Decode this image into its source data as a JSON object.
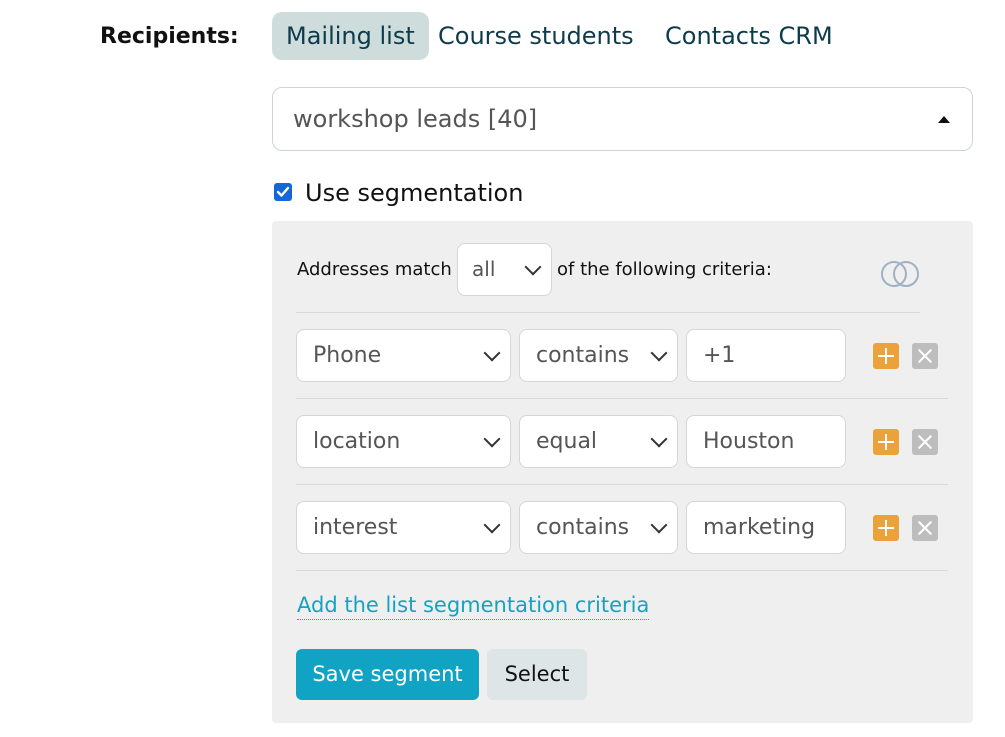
{
  "recipients_label": "Recipients:",
  "tabs": [
    {
      "label": "Mailing list",
      "active": true
    },
    {
      "label": "Course students",
      "active": false
    },
    {
      "label": "Contacts CRM",
      "active": false
    }
  ],
  "list_select": {
    "value": "workshop leads [40]"
  },
  "segmentation": {
    "checked": true,
    "label": "Use segmentation",
    "match_prefix": "Addresses match",
    "match_value": "all",
    "match_suffix": "of the following criteria:",
    "rules": [
      {
        "field": "Phone",
        "operator": "contains",
        "value": "+1"
      },
      {
        "field": "location",
        "operator": "equal",
        "value": "Houston"
      },
      {
        "field": "interest",
        "operator": "contains",
        "value": "marketing"
      }
    ],
    "add_link": "Add the list segmentation criteria",
    "save_button": "Save segment",
    "select_button": "Select"
  },
  "icons": {
    "venn": "venn-diagram-icon",
    "add": "plus-icon",
    "remove": "close-icon"
  },
  "colors": {
    "accent": "#10a3c3",
    "add_button": "#eba23a",
    "remove_button": "#bdbdbd",
    "active_tab_bg": "#cfdcdc",
    "checkbox": "#1467d6"
  }
}
